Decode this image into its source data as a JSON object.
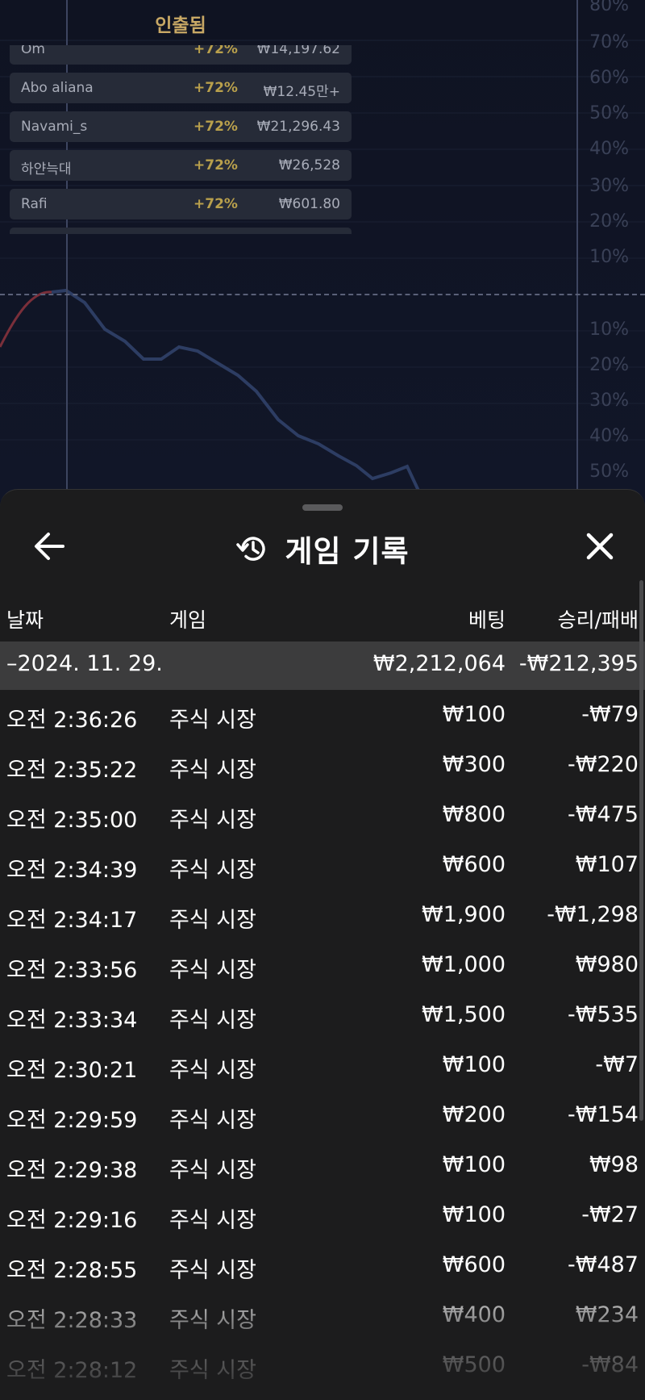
{
  "background": {
    "cashout_title": "인출됨",
    "cashouts": [
      {
        "name": "Om",
        "pct": "+72%",
        "amount": "₩14,197.62"
      },
      {
        "name": "Abo aliana",
        "pct": "+72%",
        "amount": "₩12.45만+"
      },
      {
        "name": "Navami_s",
        "pct": "+72%",
        "amount": "₩21,296.43"
      },
      {
        "name": "하얀늑대",
        "pct": "+72%",
        "amount": "₩26,528"
      },
      {
        "name": "Rafi",
        "pct": "+72%",
        "amount": "₩601.80"
      }
    ],
    "axis_labels": [
      "80%",
      "70%",
      "60%",
      "50%",
      "40%",
      "30%",
      "20%",
      "10%",
      "10%",
      "20%",
      "30%",
      "40%",
      "50%"
    ]
  },
  "sheet": {
    "title": "게임 기록",
    "columns": {
      "date": "날짜",
      "game": "게임",
      "bet": "베팅",
      "result": "승리/패배"
    },
    "date_group": {
      "date": "–2024. 11. 29.",
      "bet_total": "₩2,212,064",
      "result_total": "-₩212,395"
    },
    "rows": [
      {
        "time": "오전 2:36:26",
        "game": "주식 시장",
        "bet": "₩100",
        "result": "-₩79"
      },
      {
        "time": "오전 2:35:22",
        "game": "주식 시장",
        "bet": "₩300",
        "result": "-₩220"
      },
      {
        "time": "오전 2:35:00",
        "game": "주식 시장",
        "bet": "₩800",
        "result": "-₩475"
      },
      {
        "time": "오전 2:34:39",
        "game": "주식 시장",
        "bet": "₩600",
        "result": "₩107"
      },
      {
        "time": "오전 2:34:17",
        "game": "주식 시장",
        "bet": "₩1,900",
        "result": "-₩1,298"
      },
      {
        "time": "오전 2:33:56",
        "game": "주식 시장",
        "bet": "₩1,000",
        "result": "₩980"
      },
      {
        "time": "오전 2:33:34",
        "game": "주식 시장",
        "bet": "₩1,500",
        "result": "-₩535"
      },
      {
        "time": "오전 2:30:21",
        "game": "주식 시장",
        "bet": "₩100",
        "result": "-₩7"
      },
      {
        "time": "오전 2:29:59",
        "game": "주식 시장",
        "bet": "₩200",
        "result": "-₩154"
      },
      {
        "time": "오전 2:29:38",
        "game": "주식 시장",
        "bet": "₩100",
        "result": "₩98"
      },
      {
        "time": "오전 2:29:16",
        "game": "주식 시장",
        "bet": "₩100",
        "result": "-₩27"
      },
      {
        "time": "오전 2:28:55",
        "game": "주식 시장",
        "bet": "₩600",
        "result": "-₩487"
      },
      {
        "time": "오전 2:28:33",
        "game": "주식 시장",
        "bet": "₩400",
        "result": "₩234"
      },
      {
        "time": "오전 2:28:12",
        "game": "주식 시장",
        "bet": "₩500",
        "result": "-₩84"
      }
    ]
  },
  "icons": {
    "back": "arrow-left-icon",
    "history": "history-icon",
    "close": "close-icon"
  },
  "colors": {
    "accent_gold": "#c8a865",
    "pct_gold": "#b9a04c",
    "sheet_bg": "#1c1c1d",
    "date_row_bg": "#3c3c3d"
  }
}
